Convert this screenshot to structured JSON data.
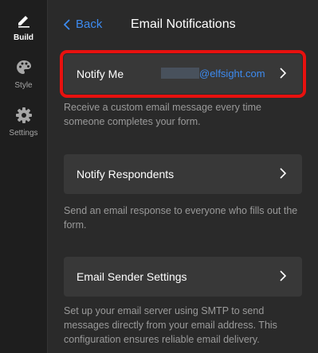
{
  "sidebar": {
    "items": [
      {
        "label": "Build",
        "icon": "pencil-icon",
        "active": true
      },
      {
        "label": "Style",
        "icon": "palette-icon",
        "active": false
      },
      {
        "label": "Settings",
        "icon": "gear-icon",
        "active": false
      }
    ]
  },
  "header": {
    "back_label": "Back",
    "title": "Email Notifications"
  },
  "sections": [
    {
      "label": "Notify Me",
      "email_domain": "@elfsight.com",
      "description": "Receive a custom email message every time someone completes your form."
    },
    {
      "label": "Notify Respondents",
      "description": "Send an email response to everyone who fills out the form."
    },
    {
      "label": "Email Sender Settings",
      "description": "Set up your email server using SMTP to send messages directly from your email address. This configuration ensures reliable email delivery."
    }
  ],
  "colors": {
    "accent": "#3d8bf0",
    "highlight": "#e8110f",
    "card_bg": "#383838",
    "panel_bg": "#2a2a2a",
    "rail_bg": "#1e1e1e"
  }
}
